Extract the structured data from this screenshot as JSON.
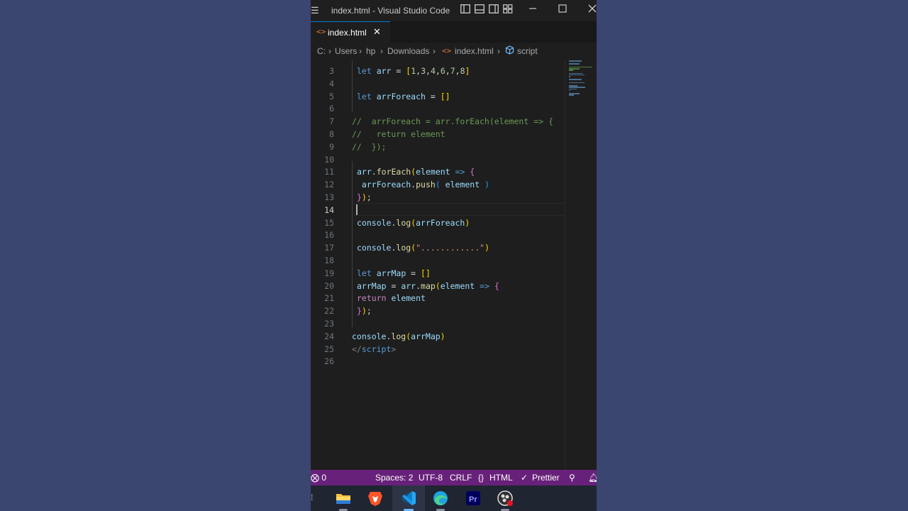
{
  "window": {
    "title": "index.html - Visual Studio Code"
  },
  "tab": {
    "label": "index.html",
    "close": "✕"
  },
  "breadcrumb": {
    "drive": "C:",
    "users": "Users",
    "hp": "hp",
    "downloads": "Downloads",
    "file": "index.html",
    "symbol": "script",
    "sep": "›"
  },
  "editor": {
    "active_line": "14",
    "lines": [
      {
        "n": "3",
        "tokens": [
          [
            "kw",
            "let "
          ],
          [
            "var",
            "arr "
          ],
          [
            "op",
            "= "
          ],
          [
            "br1",
            "["
          ],
          [
            "num",
            "1"
          ],
          [
            "op",
            ","
          ],
          [
            "num",
            "3"
          ],
          [
            "op",
            ","
          ],
          [
            "num",
            "4"
          ],
          [
            "op",
            ","
          ],
          [
            "num",
            "6"
          ],
          [
            "op",
            ","
          ],
          [
            "num",
            "7"
          ],
          [
            "op",
            ","
          ],
          [
            "num",
            "8"
          ],
          [
            "br1",
            "]"
          ]
        ]
      },
      {
        "n": "4",
        "tokens": []
      },
      {
        "n": "5",
        "tokens": [
          [
            "kw",
            "let "
          ],
          [
            "var",
            "arrForeach "
          ],
          [
            "op",
            "= "
          ],
          [
            "br1",
            "[]"
          ]
        ]
      },
      {
        "n": "6",
        "tokens": []
      },
      {
        "n": "7",
        "tokens": [
          [
            "cm",
            "//  arrForeach = arr.forEach(element => {"
          ]
        ]
      },
      {
        "n": "8",
        "tokens": [
          [
            "cm",
            "//   return element"
          ]
        ]
      },
      {
        "n": "9",
        "tokens": [
          [
            "cm",
            "//  });"
          ]
        ]
      },
      {
        "n": "10",
        "tokens": []
      },
      {
        "n": "11",
        "tokens": [
          [
            "var",
            "arr"
          ],
          [
            "op",
            "."
          ],
          [
            "fn",
            "forEach"
          ],
          [
            "br1",
            "("
          ],
          [
            "var",
            "element "
          ],
          [
            "kw",
            "=> "
          ],
          [
            "br2",
            "{"
          ]
        ]
      },
      {
        "n": "12",
        "tokens": [
          [
            "var",
            " arrForeach"
          ],
          [
            "op",
            "."
          ],
          [
            "fn",
            "push"
          ],
          [
            "br3",
            "( "
          ],
          [
            "var",
            "element "
          ],
          [
            "br3",
            ")"
          ]
        ]
      },
      {
        "n": "13",
        "tokens": [
          [
            "br2",
            "}"
          ],
          [
            "br1",
            ")"
          ],
          [
            "op",
            ";"
          ]
        ]
      },
      {
        "n": "14",
        "tokens": []
      },
      {
        "n": "15",
        "tokens": [
          [
            "var",
            "console"
          ],
          [
            "op",
            "."
          ],
          [
            "fn",
            "log"
          ],
          [
            "br1",
            "("
          ],
          [
            "var",
            "arrForeach"
          ],
          [
            "br1",
            ")"
          ]
        ]
      },
      {
        "n": "16",
        "tokens": []
      },
      {
        "n": "17",
        "tokens": [
          [
            "var",
            "console"
          ],
          [
            "op",
            "."
          ],
          [
            "fn",
            "log"
          ],
          [
            "br1",
            "("
          ],
          [
            "str",
            "\"............\""
          ],
          [
            "br1",
            ")"
          ]
        ]
      },
      {
        "n": "18",
        "tokens": []
      },
      {
        "n": "19",
        "tokens": [
          [
            "kw",
            "let "
          ],
          [
            "var",
            "arrMap "
          ],
          [
            "op",
            "= "
          ],
          [
            "br1",
            "[]"
          ]
        ]
      },
      {
        "n": "20",
        "tokens": [
          [
            "var",
            "arrMap "
          ],
          [
            "op",
            "= "
          ],
          [
            "var",
            "arr"
          ],
          [
            "op",
            "."
          ],
          [
            "fn",
            "map"
          ],
          [
            "br1",
            "("
          ],
          [
            "var",
            "element "
          ],
          [
            "kw",
            "=> "
          ],
          [
            "br2",
            "{"
          ]
        ]
      },
      {
        "n": "21",
        "tokens": [
          [
            "ctl",
            "return "
          ],
          [
            "var",
            "element"
          ]
        ]
      },
      {
        "n": "22",
        "tokens": [
          [
            "br2",
            "}"
          ],
          [
            "br1",
            ")"
          ],
          [
            "op",
            ";"
          ]
        ]
      },
      {
        "n": "23",
        "tokens": []
      },
      {
        "n": "24",
        "tokens": [
          [
            "var",
            "console"
          ],
          [
            "op",
            "."
          ],
          [
            "fn",
            "log"
          ],
          [
            "br1",
            "("
          ],
          [
            "var",
            "arrMap"
          ],
          [
            "br1",
            ")"
          ]
        ]
      },
      {
        "n": "25",
        "tokens": [
          [
            "tag",
            "</"
          ],
          [
            "tagn",
            "script"
          ],
          [
            "tag",
            ">"
          ]
        ]
      },
      {
        "n": "26",
        "tokens": []
      }
    ]
  },
  "statusbar": {
    "errors": "0",
    "spaces": "Spaces: 2",
    "encoding": "UTF-8",
    "eol": "CRLF",
    "language": "HTML",
    "formatter": "Prettier"
  },
  "taskbar": {
    "apps": [
      "file-explorer",
      "brave",
      "vscode",
      "edge",
      "premiere-pro",
      "obs"
    ]
  },
  "colors": {
    "statusbar": "#68217a",
    "tab_accent": "#0078d4",
    "background": "#3a4570"
  }
}
